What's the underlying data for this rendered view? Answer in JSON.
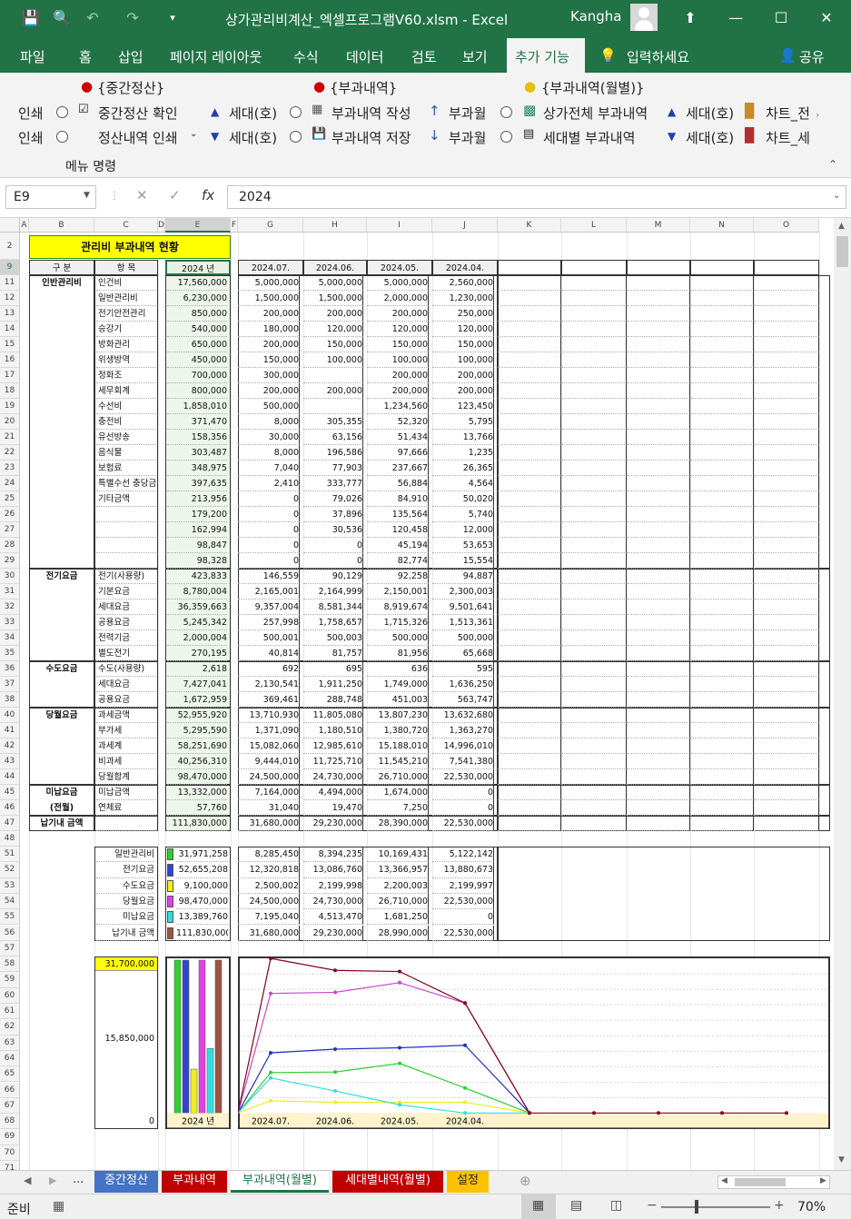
{
  "window": {
    "title": "상가관리비계산_엑셀프로그램V60.xlsm  -  Excel",
    "user": "Kangha"
  },
  "menu": {
    "tabs": [
      "파일",
      "홈",
      "삽입",
      "페이지 레이아웃",
      "수식",
      "데이터",
      "검토",
      "보기"
    ],
    "active_tab": "추가 기능",
    "tell_me": "입력하세요",
    "share": "공유"
  },
  "ribbon": {
    "group1_title": "{중간정산}",
    "group2_title": "{부과내역}",
    "group3_title": "{부과내역(월별)}",
    "print1": "인쇄",
    "print2": "인쇄",
    "mid_confirm": "중간정산 확인",
    "settle_print": "정산내역 인쇄",
    "unit_up1": "세대(호)",
    "unit_down1": "세대(호)",
    "charge_write": "부과내역 작성",
    "charge_save": "부과내역 저장",
    "month_up": "부과월",
    "month_down": "부과월",
    "all_charge": "상가전체 부과내역",
    "unit_charge": "세대별 부과내역",
    "unit_up2": "세대(호)",
    "unit_down2": "세대(호)",
    "chart1": "차트_전",
    "chart2": "차트_세",
    "menu_cmd": "메뉴 명령"
  },
  "formula_bar": {
    "name_box": "E9",
    "formula": "2024"
  },
  "sheet": {
    "columns": [
      "A",
      "B",
      "C",
      "D",
      "E",
      "F",
      "G",
      "H",
      "I",
      "J",
      "K",
      "L",
      "M",
      "N",
      "O"
    ],
    "title": "관리비 부과내역 현황",
    "header": {
      "b": "구  분",
      "c": "항  목",
      "e": "2024 년",
      "g": "2024.07.",
      "h": "2024.06.",
      "i": "2024.05.",
      "j": "2024.04."
    },
    "rows": [
      {
        "r": "11",
        "b": "인반관리비",
        "c": "인건비",
        "e": "17,560,000",
        "g": "5,000,000",
        "h": "5,000,000",
        "i": "5,000,000",
        "j": "2,560,000"
      },
      {
        "r": "12",
        "b": "",
        "c": "일반관리비",
        "e": "6,230,000",
        "g": "1,500,000",
        "h": "1,500,000",
        "i": "2,000,000",
        "j": "1,230,000"
      },
      {
        "r": "13",
        "b": "",
        "c": "전기안전관리",
        "e": "850,000",
        "g": "200,000",
        "h": "200,000",
        "i": "200,000",
        "j": "250,000"
      },
      {
        "r": "14",
        "b": "",
        "c": "승강기",
        "e": "540,000",
        "g": "180,000",
        "h": "120,000",
        "i": "120,000",
        "j": "120,000"
      },
      {
        "r": "15",
        "b": "",
        "c": "방화관리",
        "e": "650,000",
        "g": "200,000",
        "h": "150,000",
        "i": "150,000",
        "j": "150,000"
      },
      {
        "r": "16",
        "b": "",
        "c": "위생방역",
        "e": "450,000",
        "g": "150,000",
        "h": "100,000",
        "i": "100,000",
        "j": "100,000"
      },
      {
        "r": "17",
        "b": "",
        "c": "정화조",
        "e": "700,000",
        "g": "300,000",
        "h": "",
        "i": "200,000",
        "j": "200,000"
      },
      {
        "r": "18",
        "b": "",
        "c": "세무회계",
        "e": "800,000",
        "g": "200,000",
        "h": "200,000",
        "i": "200,000",
        "j": "200,000"
      },
      {
        "r": "19",
        "b": "",
        "c": "수선비",
        "e": "1,858,010",
        "g": "500,000",
        "h": "",
        "i": "1,234,560",
        "j": "123,450"
      },
      {
        "r": "20",
        "b": "",
        "c": "충전비",
        "e": "371,470",
        "g": "8,000",
        "h": "305,355",
        "i": "52,320",
        "j": "5,795"
      },
      {
        "r": "21",
        "b": "",
        "c": "유선방송",
        "e": "158,356",
        "g": "30,000",
        "h": "63,156",
        "i": "51,434",
        "j": "13,766"
      },
      {
        "r": "22",
        "b": "",
        "c": "음식물",
        "e": "303,487",
        "g": "8,000",
        "h": "196,586",
        "i": "97,666",
        "j": "1,235"
      },
      {
        "r": "23",
        "b": "",
        "c": "보험료",
        "e": "348,975",
        "g": "7,040",
        "h": "77,903",
        "i": "237,667",
        "j": "26,365"
      },
      {
        "r": "24",
        "b": "",
        "c": "특별수선 충당금",
        "e": "397,635",
        "g": "2,410",
        "h": "333,777",
        "i": "56,884",
        "j": "4,564"
      },
      {
        "r": "25",
        "b": "",
        "c": "기타금액",
        "e": "213,956",
        "g": "0",
        "h": "79,026",
        "i": "84,910",
        "j": "50,020"
      },
      {
        "r": "26",
        "b": "",
        "c": "",
        "e": "179,200",
        "g": "0",
        "h": "37,896",
        "i": "135,564",
        "j": "5,740"
      },
      {
        "r": "27",
        "b": "",
        "c": "",
        "e": "162,994",
        "g": "0",
        "h": "30,536",
        "i": "120,458",
        "j": "12,000"
      },
      {
        "r": "28",
        "b": "",
        "c": "",
        "e": "98,847",
        "g": "0",
        "h": "0",
        "i": "45,194",
        "j": "53,653"
      },
      {
        "r": "29",
        "b": "",
        "c": "",
        "e": "98,328",
        "g": "0",
        "h": "0",
        "i": "82,774",
        "j": "15,554"
      },
      {
        "r": "30",
        "b": "전기요금",
        "c": "전기(사용량)",
        "e": "423,833",
        "g": "146,559",
        "h": "90,129",
        "i": "92,258",
        "j": "94,887"
      },
      {
        "r": "31",
        "b": "",
        "c": "기본요금",
        "e": "8,780,004",
        "g": "2,165,001",
        "h": "2,164,999",
        "i": "2,150,001",
        "j": "2,300,003"
      },
      {
        "r": "32",
        "b": "",
        "c": "세대요금",
        "e": "36,359,663",
        "g": "9,357,004",
        "h": "8,581,344",
        "i": "8,919,674",
        "j": "9,501,641"
      },
      {
        "r": "33",
        "b": "",
        "c": "공용요금",
        "e": "5,245,342",
        "g": "257,998",
        "h": "1,758,657",
        "i": "1,715,326",
        "j": "1,513,361"
      },
      {
        "r": "34",
        "b": "",
        "c": "전력기금",
        "e": "2,000,004",
        "g": "500,001",
        "h": "500,003",
        "i": "500,000",
        "j": "500,000"
      },
      {
        "r": "35",
        "b": "",
        "c": "별도전기",
        "e": "270,195",
        "g": "40,814",
        "h": "81,757",
        "i": "81,956",
        "j": "65,668"
      },
      {
        "r": "36",
        "b": "수도요금",
        "c": "수도(사용량)",
        "e": "2,618",
        "g": "692",
        "h": "695",
        "i": "636",
        "j": "595"
      },
      {
        "r": "37",
        "b": "",
        "c": "세대요금",
        "e": "7,427,041",
        "g": "2,130,541",
        "h": "1,911,250",
        "i": "1,749,000",
        "j": "1,636,250"
      },
      {
        "r": "38",
        "b": "",
        "c": "공용요금",
        "e": "1,672,959",
        "g": "369,461",
        "h": "288,748",
        "i": "451,003",
        "j": "563,747"
      },
      {
        "r": "40",
        "b": "당월요금",
        "c": "과세금액",
        "e": "52,955,920",
        "g": "13,710,930",
        "h": "11,805,080",
        "i": "13,807,230",
        "j": "13,632,680"
      },
      {
        "r": "41",
        "b": "",
        "c": "부가세",
        "e": "5,295,590",
        "g": "1,371,090",
        "h": "1,180,510",
        "i": "1,380,720",
        "j": "1,363,270"
      },
      {
        "r": "42",
        "b": "",
        "c": "과세계",
        "e": "58,251,690",
        "g": "15,082,060",
        "h": "12,985,610",
        "i": "15,188,010",
        "j": "14,996,010"
      },
      {
        "r": "43",
        "b": "",
        "c": "비과세",
        "e": "40,256,310",
        "g": "9,444,010",
        "h": "11,725,710",
        "i": "11,545,210",
        "j": "7,541,380"
      },
      {
        "r": "44",
        "b": "",
        "c": "당월합계",
        "e": "98,470,000",
        "g": "24,500,000",
        "h": "24,730,000",
        "i": "26,710,000",
        "j": "22,530,000"
      },
      {
        "r": "45",
        "b": "미납요금",
        "c": "미납금액",
        "e": "13,332,000",
        "g": "7,164,000",
        "h": "4,494,000",
        "i": "1,674,000",
        "j": "0"
      },
      {
        "r": "46",
        "b": "(전월)",
        "c": "연체료",
        "e": "57,760",
        "g": "31,040",
        "h": "19,470",
        "i": "7,250",
        "j": "0"
      },
      {
        "r": "47",
        "b": "납기내 금액",
        "c": "",
        "e": "111,830,000",
        "g": "31,680,000",
        "h": "29,230,000",
        "i": "28,390,000",
        "j": "22,530,000"
      }
    ],
    "summary": [
      {
        "r": "51",
        "c": "일반관리비",
        "e": "31,971,258",
        "g": "8,285,450",
        "h": "8,394,235",
        "i": "10,169,431",
        "j": "5,122,142",
        "color": "#33cc33"
      },
      {
        "r": "52",
        "c": "전기요금",
        "e": "52,655,208",
        "g": "12,320,818",
        "h": "13,086,760",
        "i": "13,366,957",
        "j": "13,880,673",
        "color": "#3344cc"
      },
      {
        "r": "53",
        "c": "수도요금",
        "e": "9,100,000",
        "g": "2,500,002",
        "h": "2,199,998",
        "i": "2,200,003",
        "j": "2,199,997",
        "color": "#eeee22"
      },
      {
        "r": "54",
        "c": "당월요금",
        "e": "98,470,000",
        "g": "24,500,000",
        "h": "24,730,000",
        "i": "26,710,000",
        "j": "22,530,000",
        "color": "#dd44dd"
      },
      {
        "r": "55",
        "c": "미납요금",
        "e": "13,389,760",
        "g": "7,195,040",
        "h": "4,513,470",
        "i": "1,681,250",
        "j": "0",
        "color": "#33dddd"
      },
      {
        "r": "56",
        "c": "납기내 금액",
        "e": "111,830,000",
        "g": "31,680,000",
        "h": "29,230,000",
        "i": "28,990,000",
        "j": "22,530,000",
        "color": "#995544"
      }
    ],
    "axis_max": "31,700,000",
    "axis_mid": "15,850,000",
    "axis_zero": "0",
    "chart_year_label": "2024 년"
  },
  "chart_data": [
    {
      "type": "bar",
      "categories": [
        "2024 년"
      ],
      "series": [
        {
          "name": "일반관리비",
          "values": [
            31971258
          ]
        },
        {
          "name": "전기요금",
          "values": [
            52655208
          ]
        },
        {
          "name": "수도요금",
          "values": [
            9100000
          ]
        },
        {
          "name": "당월요금",
          "values": [
            98470000
          ]
        },
        {
          "name": "미납요금",
          "values": [
            13389760
          ]
        },
        {
          "name": "납기내 금액",
          "values": [
            111830000
          ]
        }
      ],
      "ylim": [
        0,
        31700000
      ]
    },
    {
      "type": "line",
      "x": [
        "2024.07.",
        "2024.06.",
        "2024.05.",
        "2024.04.",
        "",
        "",
        "",
        "",
        ""
      ],
      "series": [
        {
          "name": "일반관리비",
          "values": [
            8285450,
            8394235,
            10169431,
            5122142,
            0
          ]
        },
        {
          "name": "전기요금",
          "values": [
            12320818,
            13086760,
            13366957,
            13880673,
            0
          ]
        },
        {
          "name": "수도요금",
          "values": [
            2500002,
            2199998,
            2200003,
            2199997,
            0
          ]
        },
        {
          "name": "당월요금",
          "values": [
            24500000,
            24730000,
            26710000,
            22530000,
            0
          ]
        },
        {
          "name": "미납요금",
          "values": [
            7195040,
            4513470,
            1681250,
            0,
            0
          ]
        },
        {
          "name": "납기내 금액",
          "values": [
            31680000,
            29230000,
            28990000,
            22530000,
            0,
            0,
            0,
            0,
            0
          ]
        }
      ],
      "ylim": [
        0,
        31700000
      ]
    }
  ],
  "tabs": [
    {
      "label": "중간정산",
      "color": "#4472c4"
    },
    {
      "label": "부과내역",
      "color": "#c00000"
    },
    {
      "label": "부과내역(월별)",
      "color": "#ffffff"
    },
    {
      "label": "세대별내역(월별)",
      "color": "#c00000"
    },
    {
      "label": "설정",
      "color": "#ffc000"
    }
  ],
  "status": {
    "ready": "준비",
    "zoom": "70%"
  }
}
